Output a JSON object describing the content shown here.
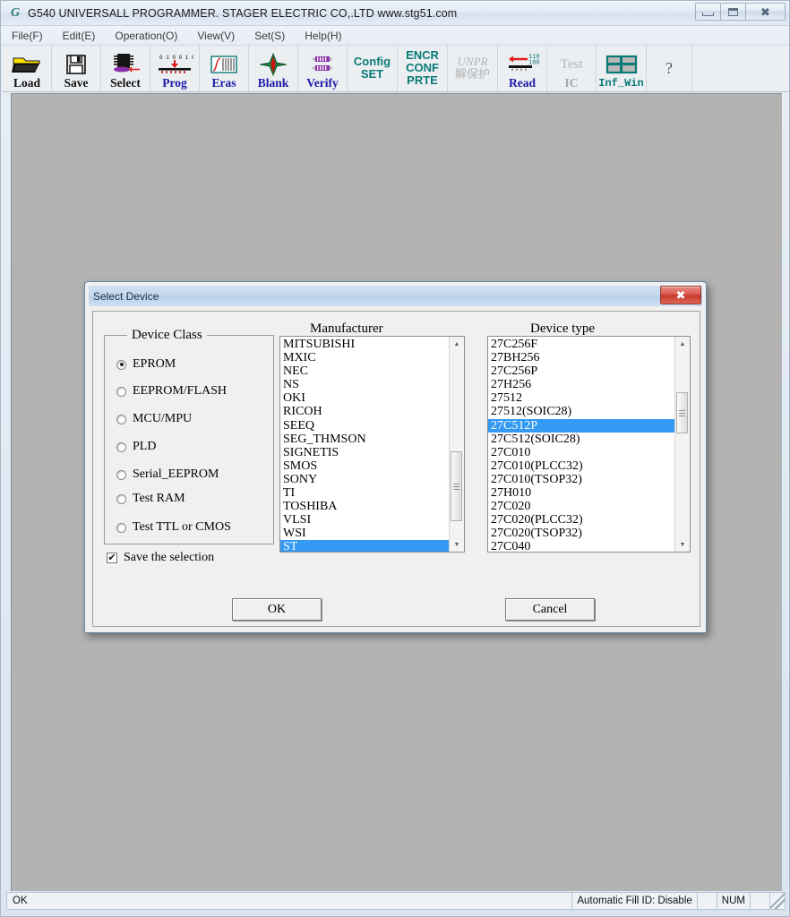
{
  "window": {
    "title": "G540 UNIVERSALL PROGRAMMER.  STAGER ELECTRIC CO,.LTD   www.stg51.com",
    "icon": "app-icon-g",
    "controls": {
      "minimize": "minimize-icon",
      "maximize": "maximize-icon",
      "close": "close-icon"
    }
  },
  "menubar": {
    "items": [
      {
        "label": "File(F)"
      },
      {
        "label": "Edit(E)"
      },
      {
        "label": "Operation(O)"
      },
      {
        "label": "View(V)"
      },
      {
        "label": "Set(S)"
      },
      {
        "label": "Help(H)"
      }
    ]
  },
  "toolbar": {
    "buttons": [
      {
        "label": "Load",
        "icon": "open-folder-icon",
        "style": "dark",
        "enabled": true
      },
      {
        "label": "Save",
        "icon": "floppy-disk-icon",
        "style": "dark",
        "enabled": true
      },
      {
        "label": "Select",
        "icon": "chip-select-icon",
        "style": "dark",
        "enabled": true
      },
      {
        "label": "Prog",
        "icon": "program-chip-icon",
        "style": "blue",
        "enabled": true
      },
      {
        "label": "Eras",
        "icon": "erase-icon",
        "style": "blue",
        "enabled": true
      },
      {
        "label": "Blank",
        "icon": "blank-check-icon",
        "style": "blue",
        "enabled": true
      },
      {
        "label": "Verify",
        "icon": "verify-icon",
        "style": "blue",
        "enabled": true
      }
    ],
    "text_buttons": [
      {
        "lines": [
          "Config",
          "SET"
        ],
        "icon": "config-set-icon",
        "enabled": true
      },
      {
        "lines": [
          "ENCR",
          "CONF",
          "PRTE"
        ],
        "icon": "encrypt-icon",
        "enabled": true
      },
      {
        "lines": [
          "UNPR",
          "解保护"
        ],
        "icon": "unprotect-icon",
        "enabled": false
      }
    ],
    "buttons2": [
      {
        "label": "Read",
        "icon": "read-icon",
        "style": "blue",
        "enabled": true
      },
      {
        "label": "IC",
        "top": "Test",
        "icon": "test-ic-icon",
        "style": "grey",
        "enabled": false
      },
      {
        "label": "Inf_Win",
        "icon": "info-window-icon",
        "style": "teal",
        "enabled": true
      }
    ],
    "help": {
      "label": "?",
      "icon": "help-icon"
    }
  },
  "dialog": {
    "title": "Select Device",
    "close_icon": "close-icon",
    "device_class": {
      "legend": "Device Class",
      "options": [
        {
          "label": "EPROM",
          "checked": true
        },
        {
          "label": "EEPROM/FLASH",
          "checked": false
        },
        {
          "label": "MCU/MPU",
          "checked": false
        },
        {
          "label": "PLD",
          "checked": false
        },
        {
          "label": "Serial_EEPROM",
          "checked": false
        },
        {
          "label": "Test RAM",
          "checked": false
        },
        {
          "label": "Test TTL or CMOS",
          "checked": false
        }
      ],
      "save_selection": {
        "label": "Save the selection",
        "checked": true,
        "mark": "✔"
      }
    },
    "manufacturer": {
      "title": "Manufacturer",
      "items": [
        "MITSUBISHI",
        "MXIC",
        "NEC",
        "NS",
        "OKI",
        "RICOH",
        "SEEQ",
        "SEG_THMSON",
        "SIGNETIS",
        "SMOS",
        "SONY",
        "TI",
        "TOSHIBA",
        "VLSI",
        "WSI",
        "ST"
      ],
      "selected": "ST"
    },
    "device_type": {
      "title": "Device type",
      "items": [
        "27C256F",
        "27BH256",
        "27C256P",
        "27H256",
        "27512",
        "27512(SOIC28)",
        "27C512P",
        "27C512(SOIC28)",
        "27C010",
        "27C010(PLCC32)",
        "27C010(TSOP32)",
        "27H010",
        "27C020",
        "27C020(PLCC32)",
        "27C020(TSOP32)",
        "27C040"
      ],
      "selected": "27C512P"
    },
    "ok_label": "OK",
    "cancel_label": "Cancel"
  },
  "statusbar": {
    "left": "OK",
    "fill_id": "Automatic Fill ID: Disable",
    "num": "NUM"
  },
  "colors": {
    "selection_blue": "#3399f3",
    "toolbar_blue": "#1a1aa8",
    "toolbar_teal": "#0a7a76",
    "client_grey": "#b3b3b3"
  }
}
